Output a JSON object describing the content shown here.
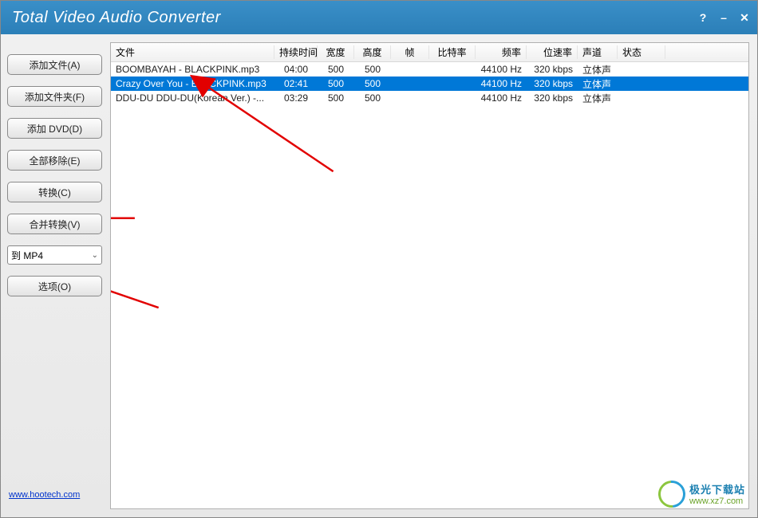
{
  "title": "Total Video Audio Converter",
  "sidebar": {
    "add_file": "添加文件(A)",
    "add_folder": "添加文件夹(F)",
    "add_dvd": "添加 DVD(D)",
    "remove_all": "全部移除(E)",
    "convert": "转换(C)",
    "merge_convert": "合并转换(V)",
    "format_select": "到 MP4",
    "options": "选项(O)"
  },
  "columns": {
    "file": "文件",
    "duration": "持续时间",
    "width": "宽度",
    "height": "高度",
    "fps": "帧",
    "bitrate": "比特率",
    "frequency": "频率",
    "bitspeed": "位速率",
    "channel": "声道",
    "status": "状态"
  },
  "rows": [
    {
      "file": "BOOMBAYAH - BLACKPINK.mp3",
      "dur": "04:00",
      "w": "500",
      "h": "500",
      "fps": "",
      "br": "",
      "freq": "44100 Hz",
      "rate": "320 kbps",
      "chan": "立体声",
      "stat": "",
      "selected": false
    },
    {
      "file": "Crazy Over You - BLACKPINK.mp3",
      "dur": "02:41",
      "w": "500",
      "h": "500",
      "fps": "",
      "br": "",
      "freq": "44100 Hz",
      "rate": "320 kbps",
      "chan": "立体声",
      "stat": "",
      "selected": true
    },
    {
      "file": "DDU-DU DDU-DU(Korean Ver.) -...",
      "dur": "03:29",
      "w": "500",
      "h": "500",
      "fps": "",
      "br": "",
      "freq": "44100 Hz",
      "rate": "320 kbps",
      "chan": "立体声",
      "stat": "",
      "selected": false
    }
  ],
  "footer_link": "www.hootech.com",
  "watermark": {
    "cn": "极光下载站",
    "url": "www.xz7.com"
  }
}
